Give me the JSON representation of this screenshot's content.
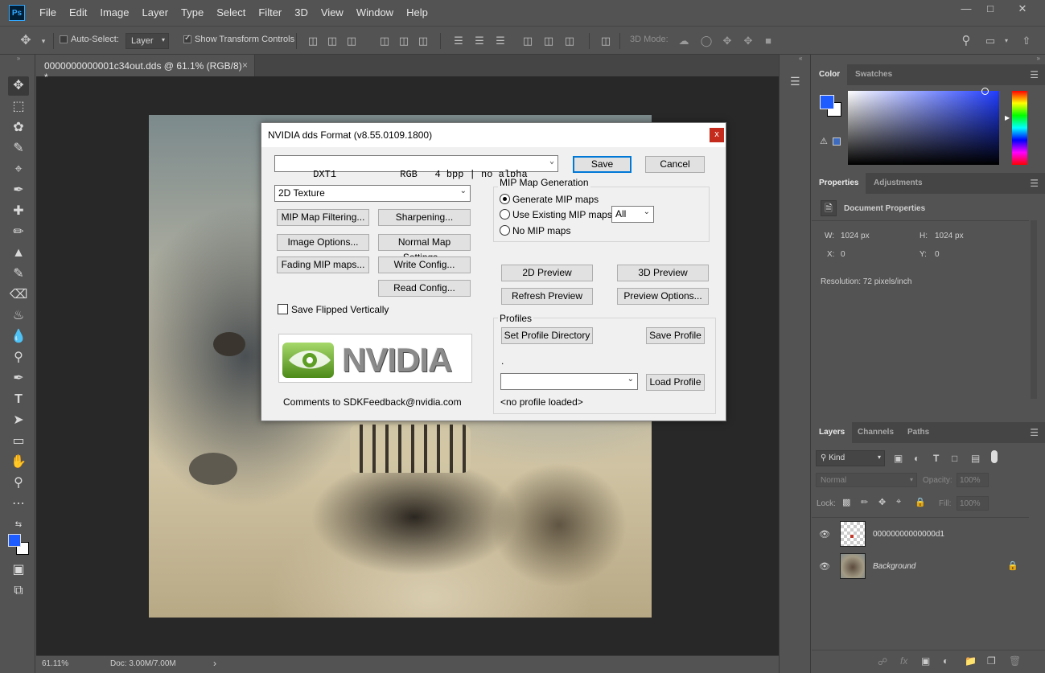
{
  "app": {
    "logo": "Ps",
    "menu": [
      "File",
      "Edit",
      "Image",
      "Layer",
      "Type",
      "Select",
      "Filter",
      "3D",
      "View",
      "Window",
      "Help"
    ]
  },
  "options_bar": {
    "auto_select_label": "Auto-Select:",
    "auto_select_target": "Layer",
    "show_transform_label": "Show Transform Controls",
    "mode_3d_label": "3D Mode:"
  },
  "document": {
    "tab_title": "0000000000001c34out.dds @ 61.1% (RGB/8) *",
    "zoom": "61.11%",
    "doc_info": "Doc: 3.00M/7.00M"
  },
  "color_panel": {
    "tabs": [
      "Color",
      "Swatches"
    ],
    "foreground_color": "#1f5cff"
  },
  "properties_panel": {
    "tabs": [
      "Properties",
      "Adjustments"
    ],
    "heading": "Document Properties",
    "w_label": "W:",
    "w_value": "1024 px",
    "h_label": "H:",
    "h_value": "1024 px",
    "x_label": "X:",
    "x_value": "0",
    "y_label": "Y:",
    "y_value": "0",
    "resolution": "Resolution: 72 pixels/inch"
  },
  "layers_panel": {
    "tabs": [
      "Layers",
      "Channels",
      "Paths"
    ],
    "filter_kind": "Kind",
    "blend_mode": "Normal",
    "opacity_label": "Opacity:",
    "opacity_value": "100%",
    "lock_label": "Lock:",
    "fill_label": "Fill:",
    "fill_value": "100%",
    "layers": [
      {
        "name": "00000000000000d1"
      },
      {
        "name": "Background"
      }
    ]
  },
  "dialog": {
    "title": "NVIDIA dds Format (v8.55.0109.1800)",
    "close": "x",
    "format": "DXT1           RGB   4 bpp | no alpha",
    "save": "Save",
    "cancel": "Cancel",
    "texture_type": "2D Texture",
    "mip_filtering": "MIP Map Filtering...",
    "sharpening": "Sharpening...",
    "image_options": "Image Options...",
    "normal_map_settings": "Normal Map Settings...",
    "fading_mip": "Fading MIP maps...",
    "write_config": "Write Config...",
    "read_config": "Read Config...",
    "save_flipped": "Save Flipped Vertically",
    "mip_group": "MIP Map Generation",
    "generate_mip": "Generate MIP maps",
    "use_existing_mip": "Use Existing MIP maps",
    "existing_mip_value": "All",
    "no_mip": "No MIP maps",
    "preview_2d": "2D Preview",
    "preview_3d": "3D Preview",
    "refresh_preview": "Refresh Preview",
    "preview_options": "Preview Options...",
    "profiles_group": "Profiles",
    "set_profile_dir": "Set Profile Directory",
    "save_profile": "Save Profile",
    "profile_path": ".",
    "load_profile": "Load Profile",
    "profile_status": "<no profile loaded>",
    "nvidia_logo_text": "NVIDIA",
    "comments": "Comments to SDKFeedback@nvidia.com"
  }
}
